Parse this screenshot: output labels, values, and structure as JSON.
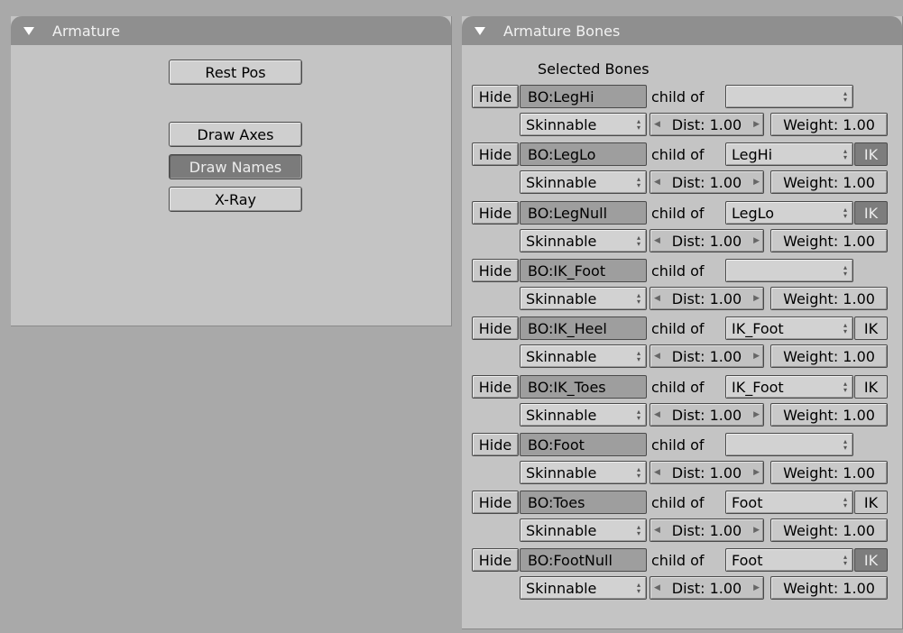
{
  "armature_panel": {
    "title": "Armature",
    "rest_pos": "Rest Pos",
    "draw_axes": "Draw Axes",
    "draw_names": "Draw Names",
    "xray": "X-Ray"
  },
  "bones_panel": {
    "title": "Armature Bones",
    "selected_label": "Selected Bones",
    "hide_label": "Hide",
    "child_of_label": "child of",
    "ik_label": "IK",
    "skin_label": "Skinnable",
    "dist_label": "Dist: 1.00",
    "weight_label": "Weight: 1.00",
    "bones": [
      {
        "name": "BO:LegHi",
        "parent": "",
        "ik_visible": false,
        "ik_active": false
      },
      {
        "name": "BO:LegLo",
        "parent": "LegHi",
        "ik_visible": true,
        "ik_active": true
      },
      {
        "name": "BO:LegNull",
        "parent": "LegLo",
        "ik_visible": true,
        "ik_active": true
      },
      {
        "name": "BO:IK_Foot",
        "parent": "",
        "ik_visible": false,
        "ik_active": false
      },
      {
        "name": "BO:IK_Heel",
        "parent": "IK_Foot",
        "ik_visible": true,
        "ik_active": false
      },
      {
        "name": "BO:IK_Toes",
        "parent": "IK_Foot",
        "ik_visible": true,
        "ik_active": false
      },
      {
        "name": "BO:Foot",
        "parent": "",
        "ik_visible": false,
        "ik_active": false
      },
      {
        "name": "BO:Toes",
        "parent": "Foot",
        "ik_visible": true,
        "ik_active": false
      },
      {
        "name": "BO:FootNull",
        "parent": "Foot",
        "ik_visible": true,
        "ik_active": true
      }
    ]
  }
}
